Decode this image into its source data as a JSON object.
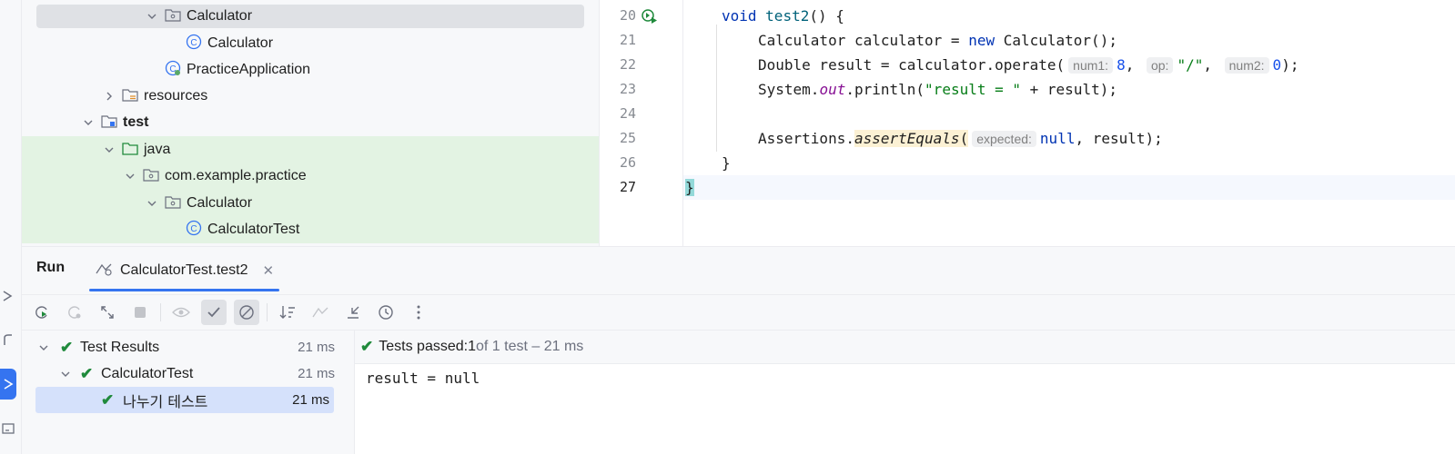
{
  "project_tree": [
    {
      "label": "Calculator",
      "kind": "package",
      "expanded": true,
      "selected": true
    },
    {
      "label": "Calculator",
      "kind": "class"
    },
    {
      "label": "PracticeApplication",
      "kind": "spring-class"
    },
    {
      "label": "resources",
      "kind": "resources-folder",
      "expanded": false
    },
    {
      "label": "test",
      "kind": "module-folder",
      "expanded": true
    },
    {
      "label": "java",
      "kind": "test-source-folder",
      "expanded": true
    },
    {
      "label": "com.example.practice",
      "kind": "package",
      "expanded": true
    },
    {
      "label": "Calculator",
      "kind": "package",
      "expanded": true
    },
    {
      "label": "CalculatorTest",
      "kind": "class"
    }
  ],
  "editor": {
    "line_numbers": [
      "20",
      "21",
      "22",
      "23",
      "24",
      "25",
      "26",
      "27"
    ],
    "line20": {
      "kw": "void",
      "name": "test2",
      "rest": "() {"
    },
    "line21": {
      "type": "Calculator calculator = ",
      "kw": "new",
      "rest": " Calculator();"
    },
    "line22": {
      "a": "Double result = calculator.operate(",
      "hint1": "num1:",
      "v1": "8",
      "hint2": "op:",
      "v2": "\"/\"",
      "hint3": "num2:",
      "v3": "0",
      "end": ");"
    },
    "line23": {
      "a": "System.",
      "fld": "out",
      "b": ".println(",
      "str": "\"result = \"",
      "c": " + result);"
    },
    "line25": {
      "a": "Assertions.",
      "method": "assertEquals",
      "open": "(",
      "hint": "expected:",
      "kw": "null",
      "end": ", result);"
    },
    "line26": "}",
    "line27": "}"
  },
  "run_panel": {
    "title": "Run",
    "tab_label": "CalculatorTest.test2",
    "results": [
      {
        "label": "Test Results",
        "time": "21 ms"
      },
      {
        "label": "CalculatorTest",
        "time": "21 ms"
      },
      {
        "label": "나누기 테스트",
        "time": "21 ms"
      }
    ],
    "status": {
      "prefix": "Tests passed: ",
      "count": "1",
      "suffix": " of 1 test – 21 ms"
    },
    "output": "result = null"
  },
  "colors": {
    "accent": "#3574f0",
    "pass": "#208a3c",
    "tree_green": "#e3f3e3"
  }
}
